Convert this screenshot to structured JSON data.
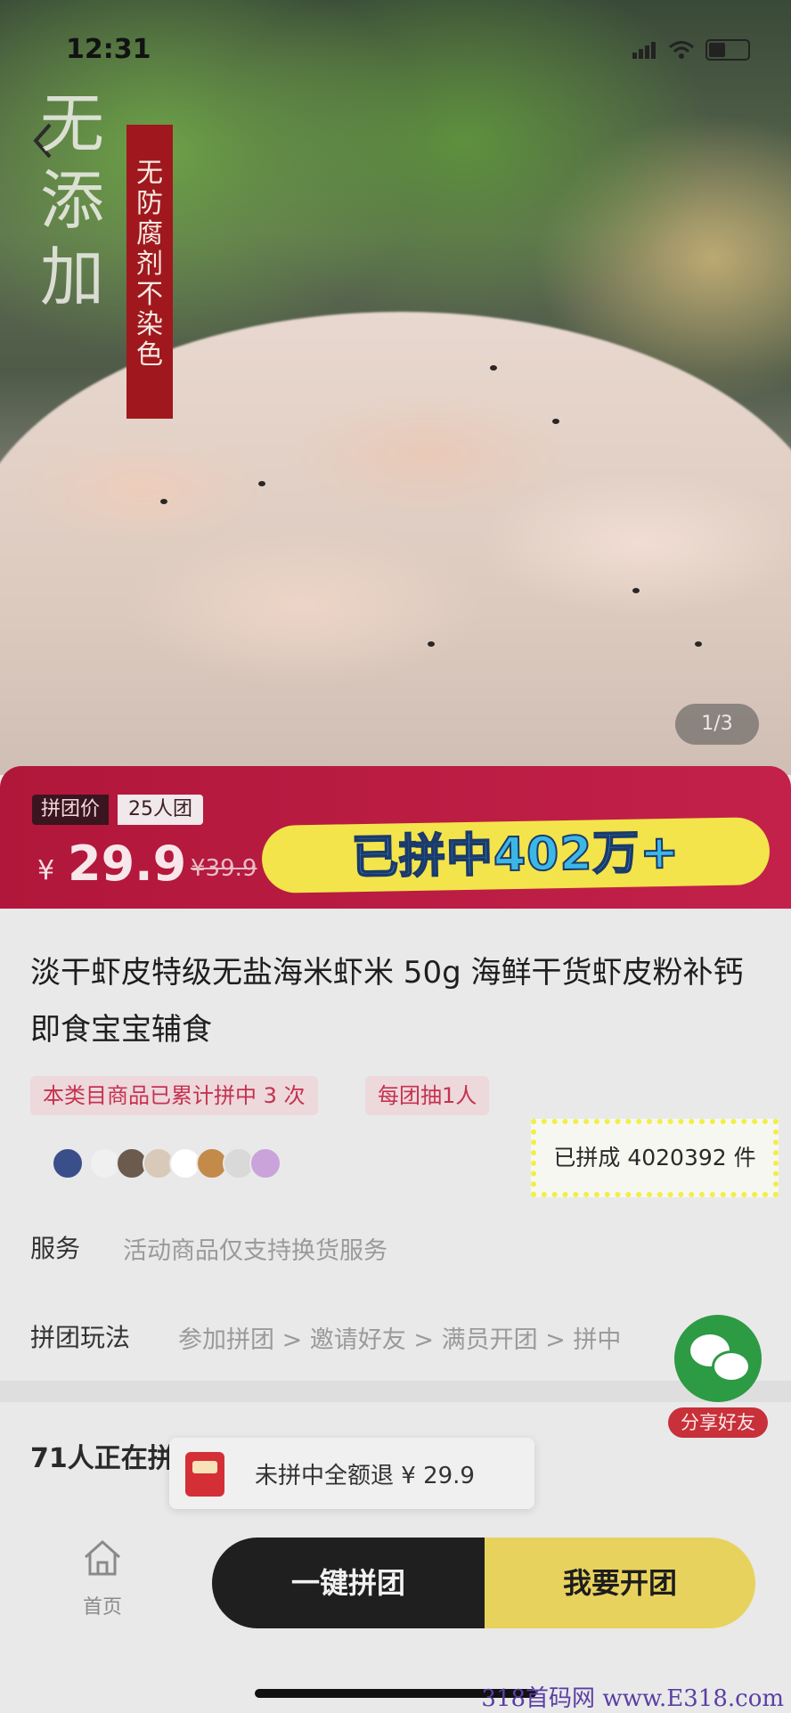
{
  "status_bar": {
    "time": "12:31"
  },
  "hero": {
    "slogan": "无添加",
    "banner": "无防腐剂 不染色",
    "image_counter": "1/3"
  },
  "price": {
    "group_tag": "拼团价",
    "group_size": "25人团",
    "currency": "¥",
    "current": "29.9",
    "original": "¥39.9",
    "promo_badge": "已拼中402万+"
  },
  "product": {
    "title": "淡干虾皮特级无盐海米虾米 50g 海鲜干货虾皮粉补钙即食宝宝辅食",
    "tag_count": "本类目商品已累计拼中 3 次",
    "tag_draw": "每团抽1人",
    "sold": "已拼成 4020392 件"
  },
  "service": {
    "label": "服务",
    "value": "活动商品仅支持换货服务"
  },
  "play": {
    "label": "拼团玩法",
    "value": "参加拼团 > 邀请好友 > 满员开团 > 拼中"
  },
  "groups": {
    "heading": "71人正在拼团，快来一起参拼"
  },
  "share": {
    "label": "分享好友"
  },
  "refund": {
    "text": "未拼中全额退 ¥ 29.9"
  },
  "bottom_bar": {
    "home_label": "首页",
    "join_button": "一键拼团",
    "open_button": "我要开团"
  },
  "watermark": "318首码网 www.E318.com"
}
